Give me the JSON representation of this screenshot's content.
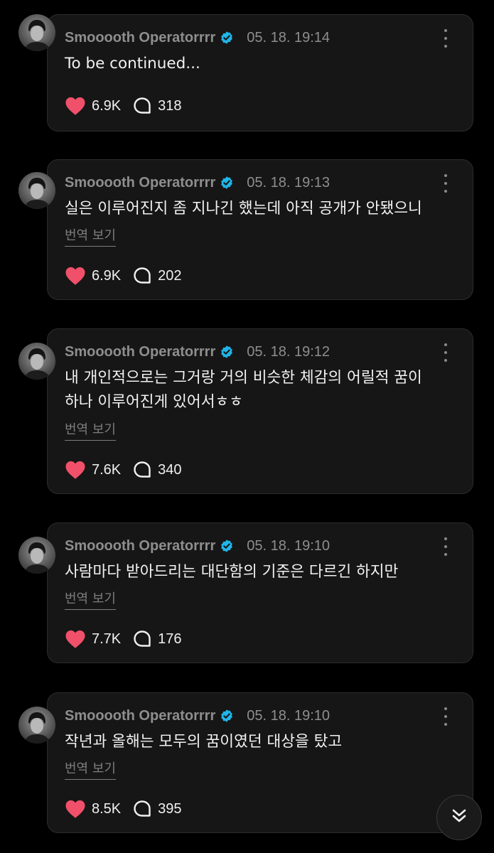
{
  "posts": [
    {
      "username": "Smooooth Operatorrrr",
      "time": "05. 18. 19:14",
      "text_lines": [
        "To be continued..."
      ],
      "translate_label": "",
      "likes": "6.9K",
      "comments": "318"
    },
    {
      "username": "Smooooth Operatorrrr",
      "time": "05. 18. 19:13",
      "text_lines": [
        "실은 이루어진지 좀 지나긴 했는데 아직 공개가 안됐으니"
      ],
      "translate_label": "번역 보기",
      "likes": "6.9K",
      "comments": "202"
    },
    {
      "username": "Smooooth Operatorrrr",
      "time": "05. 18. 19:12",
      "text_lines": [
        "내 개인적으로는 그거랑 거의 비슷한 체감의 어릴적 꿈이",
        "하나 이루어진게 있어서ㅎㅎ"
      ],
      "translate_label": "번역 보기",
      "likes": "7.6K",
      "comments": "340"
    },
    {
      "username": "Smooooth Operatorrrr",
      "time": "05. 18. 19:10",
      "text_lines": [
        "사람마다 받아드리는 대단함의 기준은 다르긴 하지만"
      ],
      "translate_label": "번역 보기",
      "likes": "7.7K",
      "comments": "176"
    },
    {
      "username": "Smooooth Operatorrrr",
      "time": "05. 18. 19:10",
      "text_lines": [
        "작년과 올해는 모두의 꿈이였던 대상을 탔고"
      ],
      "translate_label": "번역 보기",
      "likes": "8.5K",
      "comments": "395"
    }
  ],
  "icons": {
    "verified": "verified-badge-icon",
    "more": "more-options-icon",
    "like": "heart-icon",
    "comment": "comment-bubble-icon",
    "scroll": "double-chevron-down-icon"
  },
  "colors": {
    "background": "#000000",
    "card": "#161616",
    "heart": "#f0506a",
    "verified": "#1fb5e8",
    "muted_text": "#8e8e8e"
  }
}
